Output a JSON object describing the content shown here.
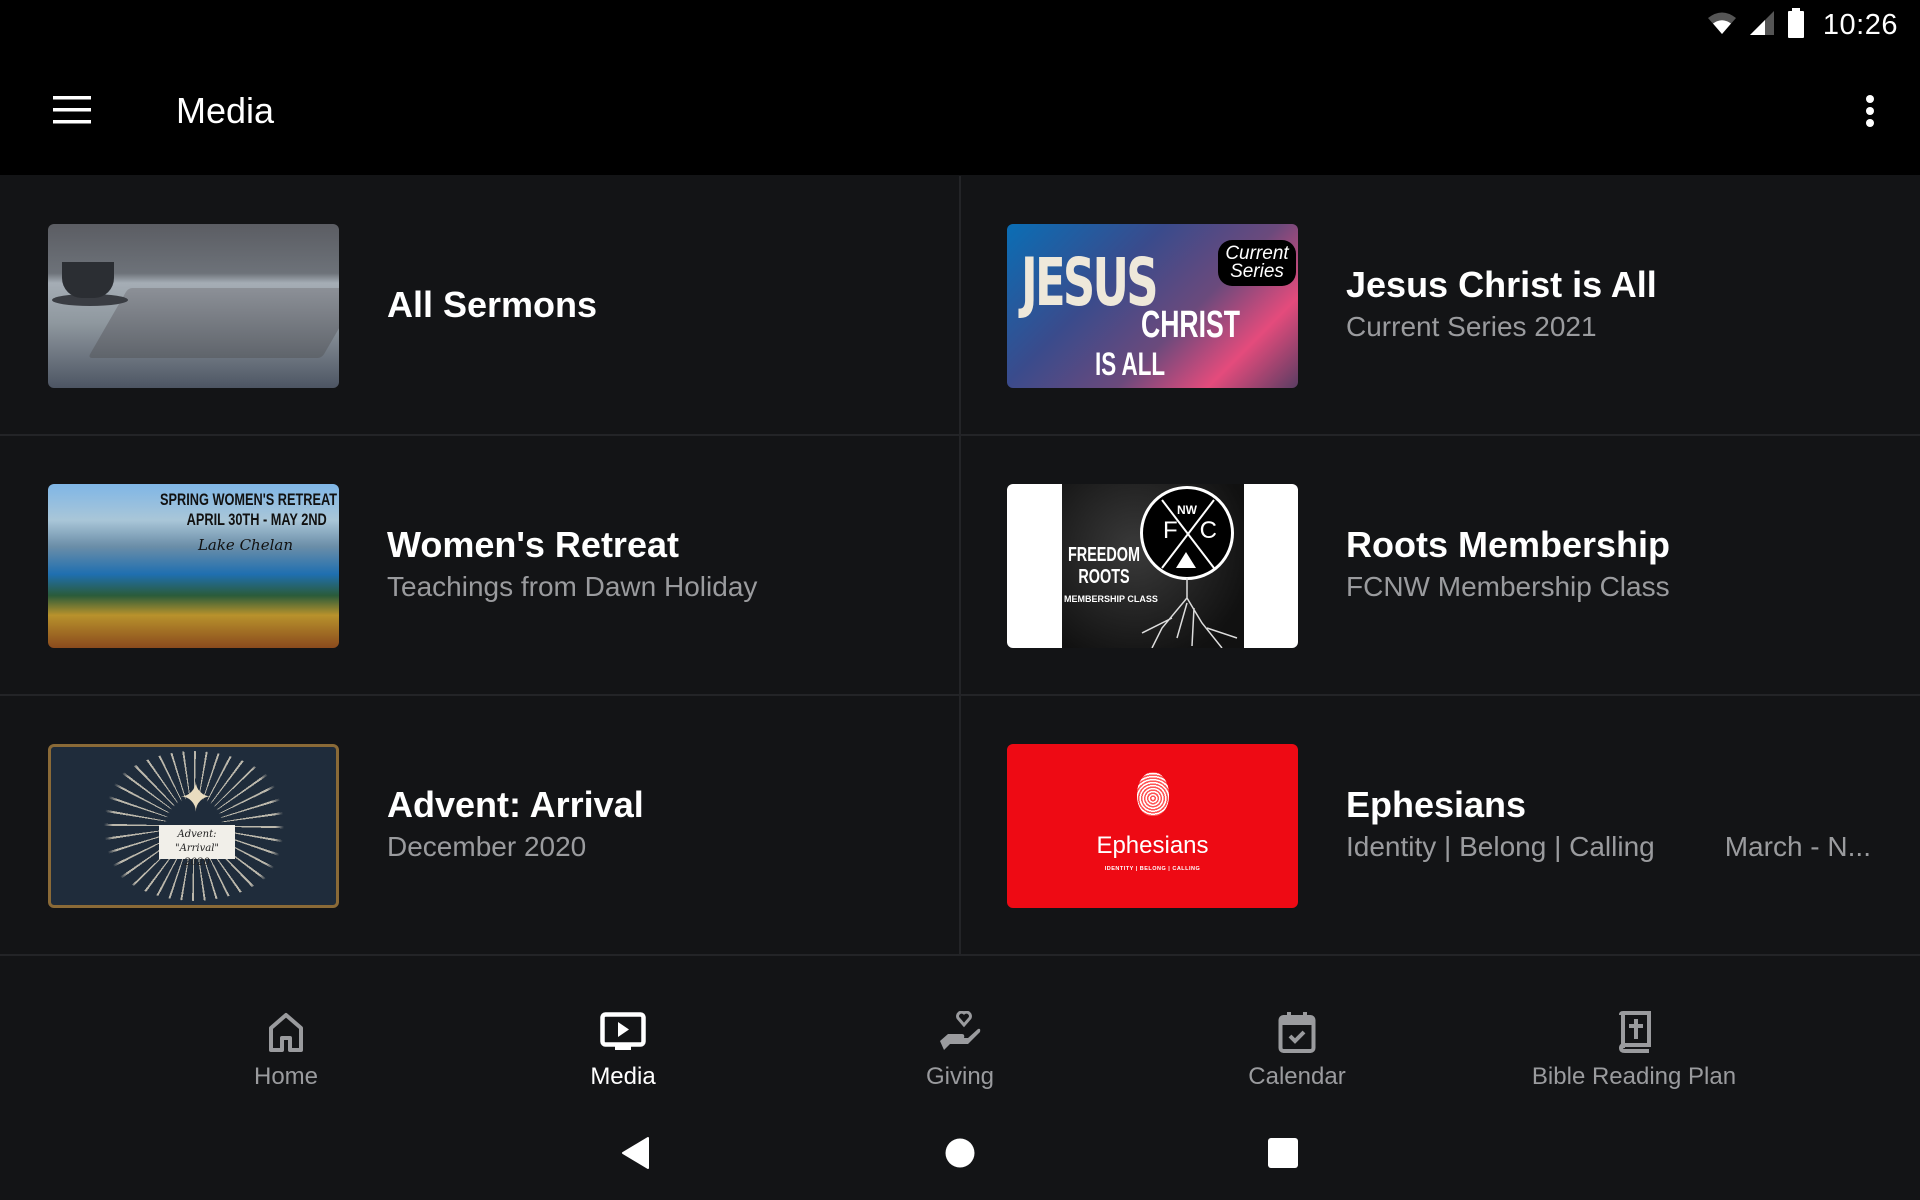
{
  "status_bar": {
    "time": "10:26",
    "icons": [
      "wifi-icon",
      "cellular-signal-icon",
      "battery-icon"
    ]
  },
  "app_bar": {
    "title": "Media",
    "menu_icon": "hamburger-menu-icon",
    "more_icon": "more-vertical-icon"
  },
  "media_items": [
    {
      "title": "All Sermons",
      "subtitle": "",
      "thumbnail": {
        "description": "open bible and coffee cup"
      }
    },
    {
      "title": "Jesus Christ is All",
      "subtitle": "Current Series 2021",
      "thumbnail": {
        "line1": "JESUS",
        "line2": "CHRIST",
        "line3": "IS ALL",
        "badge": "Current Series"
      }
    },
    {
      "title": "Women's Retreat",
      "subtitle": "Teachings from Dawn Holiday",
      "thumbnail": {
        "line1": "SPRING WOMEN'S RETREAT",
        "line2": "APRIL 30TH - MAY 2ND",
        "line3": "Lake Chelan"
      }
    },
    {
      "title": "Roots Membership",
      "subtitle": "FCNW Membership Class",
      "thumbnail": {
        "logo_top": "NW",
        "logo_letters": "FC",
        "line1": "FREEDOM",
        "line2": "ROOTS",
        "line3": "MEMBERSHIP CLASS"
      }
    },
    {
      "title": "Advent: Arrival",
      "subtitle": "December 2020",
      "thumbnail": {
        "label_line1": "Advent: \"Arrival\"",
        "label_line2": "2020"
      }
    },
    {
      "title": "Ephesians",
      "subtitle": "Identity | Belong | Calling",
      "extra": "March - N...",
      "thumbnail": {
        "word": "Ephesians",
        "tagline": "IDENTITY | BELONG | CALLING"
      }
    }
  ],
  "bottom_nav": [
    {
      "label": "Home",
      "icon": "home-icon",
      "active": false
    },
    {
      "label": "Media",
      "icon": "media-play-icon",
      "active": true
    },
    {
      "label": "Giving",
      "icon": "giving-hand-heart-icon",
      "active": false
    },
    {
      "label": "Calendar",
      "icon": "calendar-check-icon",
      "active": false
    },
    {
      "label": "Bible Reading Plan",
      "icon": "bible-icon",
      "active": false
    }
  ],
  "system_nav": [
    "back-icon",
    "home-circle-icon",
    "recents-square-icon"
  ],
  "colors": {
    "background": "#131416",
    "app_bar": "#000000",
    "text_primary": "#ffffff",
    "text_secondary": "#9a9b9e",
    "divider": "#232427",
    "ephesians_red": "#ee0a14"
  }
}
